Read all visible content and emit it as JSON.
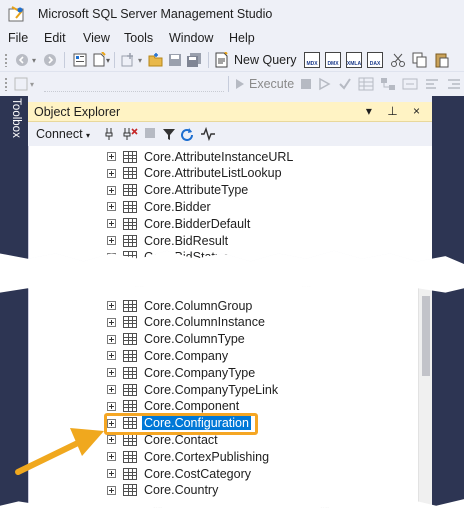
{
  "app": {
    "title": "Microsoft SQL Server Management Studio"
  },
  "menu": {
    "items": [
      "File",
      "Edit",
      "View",
      "Tools",
      "Window",
      "Help"
    ]
  },
  "toolbar": {
    "new_query_label": "New Query",
    "execute_label": "Execute",
    "query_icons": [
      "MDX",
      "DMX",
      "XMLA",
      "DAX"
    ]
  },
  "toolbox": {
    "label": "Toolbox"
  },
  "object_explorer": {
    "title": "Object Explorer",
    "pin_glyph": "▾ ⊥ ×",
    "connect_label": "Connect"
  },
  "tree_top": {
    "items": [
      "Core.AttributeInstanceURL",
      "Core.AttributeListLookup",
      "Core.AttributeType",
      "Core.Bidder",
      "Core.BidderDefault",
      "Core.BidResult",
      "Core.BidStatus"
    ]
  },
  "tree_bottom": {
    "items": [
      "Core.ColumnGroup",
      "Core.ColumnInstance",
      "Core.ColumnType",
      "Core.Company",
      "Core.CompanyType",
      "Core.CompanyTypeLink",
      "Core.Component",
      "Core.Configuration",
      "Core.Contact",
      "Core.CortexPublishing",
      "Core.CostCategory",
      "Core.Country"
    ],
    "selected": "Core.Configuration"
  },
  "colors": {
    "accent": "#f5a623",
    "selection": "#0078d7",
    "dark_chrome": "#2d3553",
    "panel_header": "#fff3c4"
  }
}
